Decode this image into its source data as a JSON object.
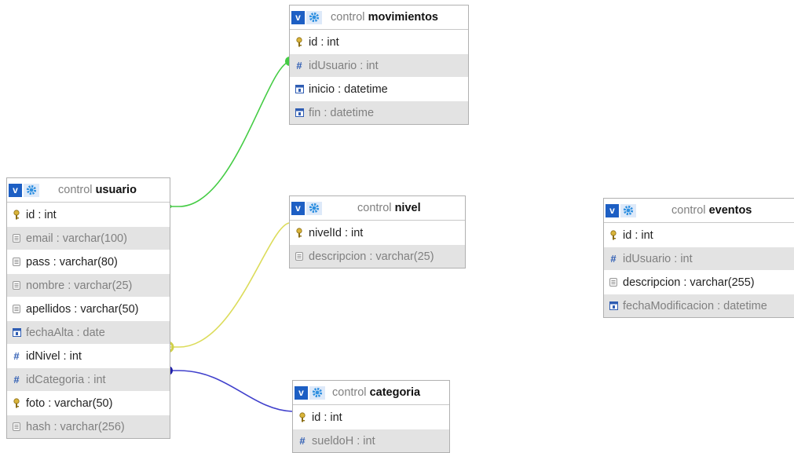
{
  "tables": {
    "movimientos": {
      "db": "control",
      "name": "movimientos",
      "columns": [
        {
          "label": "id : int",
          "icon": "key-icon"
        },
        {
          "label": "idUsuario : int",
          "icon": "hash-icon"
        },
        {
          "label": "inicio : datetime",
          "icon": "calendar-icon"
        },
        {
          "label": "fin : datetime",
          "icon": "calendar-icon"
        }
      ]
    },
    "usuario": {
      "db": "control",
      "name": "usuario",
      "columns": [
        {
          "label": "id : int",
          "icon": "key-icon"
        },
        {
          "label": "email : varchar(100)",
          "icon": "text-icon"
        },
        {
          "label": "pass : varchar(80)",
          "icon": "text-icon"
        },
        {
          "label": "nombre : varchar(25)",
          "icon": "text-icon"
        },
        {
          "label": "apellidos : varchar(50)",
          "icon": "text-icon"
        },
        {
          "label": "fechaAlta : date",
          "icon": "calendar-icon"
        },
        {
          "label": "idNivel : int",
          "icon": "hash-icon"
        },
        {
          "label": "idCategoria : int",
          "icon": "hash-icon"
        },
        {
          "label": "foto : varchar(50)",
          "icon": "key-icon"
        },
        {
          "label": "hash : varchar(256)",
          "icon": "text-icon"
        }
      ]
    },
    "nivel": {
      "db": "control",
      "name": "nivel",
      "columns": [
        {
          "label": "nivelId : int",
          "icon": "key-icon"
        },
        {
          "label": "descripcion : varchar(25)",
          "icon": "text-icon"
        }
      ]
    },
    "categoria": {
      "db": "control",
      "name": "categoria",
      "columns": [
        {
          "label": "id : int",
          "icon": "key-icon"
        },
        {
          "label": "sueldoH : int",
          "icon": "hash-icon"
        }
      ]
    },
    "eventos": {
      "db": "control",
      "name": "eventos",
      "columns": [
        {
          "label": "id : int",
          "icon": "key-icon"
        },
        {
          "label": "idUsuario : int",
          "icon": "hash-icon"
        },
        {
          "label": "descripcion : varchar(255)",
          "icon": "text-icon"
        },
        {
          "label": "fechaModificacion : datetime",
          "icon": "calendar-icon"
        }
      ]
    }
  },
  "header_button": "v",
  "colors": {
    "relation_usuario_movimientos": "#44cc44",
    "relation_usuario_nivel": "#dcdc5a",
    "relation_usuario_categoria": "#4040cc",
    "v_button": "#1d5fc4"
  }
}
